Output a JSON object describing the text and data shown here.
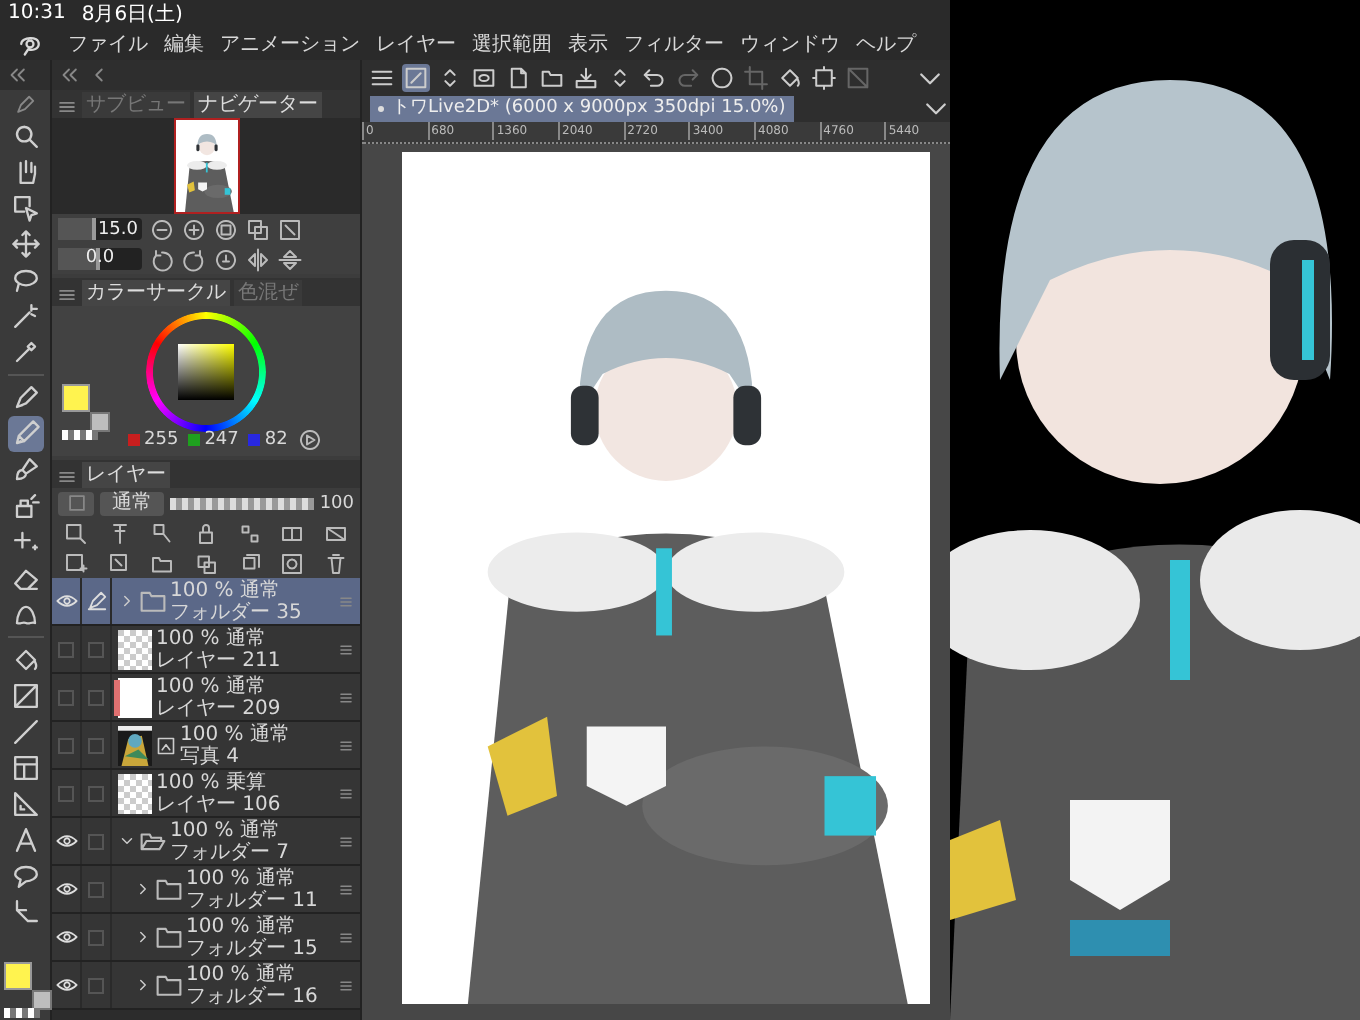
{
  "status_bar": {
    "time": "10:31",
    "date": "8月6日(土)"
  },
  "menu": [
    "ファイル",
    "編集",
    "アニメーション",
    "レイヤー",
    "選択範囲",
    "表示",
    "フィルター",
    "ウィンドウ",
    "ヘルプ"
  ],
  "tools": [
    {
      "kind": "zoom",
      "selected": false
    },
    {
      "kind": "hand",
      "selected": false
    },
    {
      "kind": "select",
      "selected": false
    },
    {
      "kind": "move",
      "selected": false
    },
    {
      "kind": "lasso",
      "selected": false
    },
    {
      "kind": "wand",
      "selected": false
    },
    {
      "kind": "eyedropper",
      "selected": false
    },
    {
      "kind": "pen",
      "selected": false
    },
    {
      "kind": "pencil",
      "selected": true
    },
    {
      "kind": "brush",
      "selected": false
    },
    {
      "kind": "decoration",
      "selected": false
    },
    {
      "kind": "sparkle",
      "selected": false
    },
    {
      "kind": "eraser",
      "selected": false
    },
    {
      "kind": "blend",
      "selected": false
    },
    {
      "kind": "fill",
      "selected": false
    },
    {
      "kind": "gradient",
      "selected": false
    },
    {
      "kind": "line",
      "selected": false
    },
    {
      "kind": "frame",
      "selected": false
    },
    {
      "kind": "ruler",
      "selected": false
    },
    {
      "kind": "text",
      "selected": false
    },
    {
      "kind": "balloon",
      "selected": false
    },
    {
      "kind": "correction",
      "selected": false
    }
  ],
  "navigator": {
    "tabs": [
      {
        "label": "サブビュー",
        "selected": false
      },
      {
        "label": "ナビゲーター",
        "selected": true
      }
    ],
    "zoom_slider": {
      "value": "15.0",
      "level": 0.45
    },
    "rotation_slider": {
      "value": "0.0",
      "level": 0.5
    }
  },
  "color_panel": {
    "tabs": [
      {
        "label": "カラーサークル",
        "selected": true
      },
      {
        "label": "色混ぜ",
        "selected": false
      }
    ],
    "rgb": [
      {
        "value": "255",
        "color": "#c81e1e"
      },
      {
        "value": "247",
        "color": "#1ea01e"
      },
      {
        "value": "82",
        "color": "#2828e0"
      }
    ]
  },
  "layers": {
    "tab": "レイヤー",
    "blend_mode": "通常",
    "opacity": {
      "value": "100",
      "level": 1
    },
    "items": [
      {
        "kind": "folder",
        "blend": "100 % 通常",
        "name": "フォルダー 35",
        "visible": true,
        "selected": true,
        "expanded": false
      },
      {
        "kind": "raster",
        "blend": "100 % 通常",
        "name": "レイヤー 211",
        "visible": false,
        "selected": false
      },
      {
        "kind": "paper",
        "blend": "100 % 通常",
        "name": "レイヤー 209",
        "visible": false,
        "selected": false,
        "color": "#e07070"
      },
      {
        "blend": "100 % 通常",
        "name": "写真 4",
        "visible": false,
        "selected": false
      },
      {
        "kind": "raster",
        "blend": "100 % 乗算",
        "name": "レイヤー 106",
        "visible": false,
        "selected": false
      },
      {
        "kind": "folder",
        "blend": "100 % 通常",
        "name": "フォルダー 7",
        "visible": true,
        "selected": false,
        "expanded": true,
        "children": [
          {
            "kind": "folder",
            "blend": "100 % 通常",
            "name": "フォルダー 11",
            "visible": true,
            "selected": false,
            "expanded": false
          },
          {
            "kind": "folder",
            "blend": "100 % 通常",
            "name": "フォルダー 15",
            "visible": true,
            "selected": false,
            "expanded": false
          },
          {
            "kind": "folder",
            "blend": "100 % 通常",
            "name": "フォルダー 16",
            "visible": true,
            "selected": false,
            "expanded": false
          }
        ]
      }
    ]
  },
  "toolbar": [
    {
      "kind": "menu",
      "selected": false,
      "disabled": false
    },
    {
      "kind": "transform",
      "selected": true,
      "disabled": false
    },
    {
      "kind": "updown",
      "selected": false,
      "disabled": false
    },
    {
      "kind": "preview",
      "selected": false,
      "disabled": false
    },
    {
      "kind": "new",
      "selected": false,
      "disabled": false
    },
    {
      "kind": "open",
      "selected": false,
      "disabled": false
    },
    {
      "kind": "save",
      "selected": false,
      "disabled": false
    },
    {
      "kind": "updown",
      "selected": false,
      "disabled": false
    },
    {
      "kind": "undo",
      "selected": false,
      "disabled": false
    },
    {
      "kind": "redo",
      "selected": false,
      "disabled": true
    },
    {
      "kind": "selection",
      "selected": false,
      "disabled": false
    },
    {
      "kind": "crop",
      "selected": false,
      "disabled": true
    },
    {
      "kind": "fill",
      "selected": false,
      "disabled": false
    },
    {
      "kind": "cropframe",
      "selected": false,
      "disabled": false
    },
    {
      "kind": "nodraw",
      "selected": false,
      "disabled": true
    }
  ],
  "canvas": {
    "tab": "トワLive2D* (6000 x 9000px 350dpi 15.0%)",
    "ruler": [
      "0",
      "680",
      "1360",
      "2040",
      "2720",
      "3400",
      "4080",
      "4760",
      "5440"
    ]
  }
}
